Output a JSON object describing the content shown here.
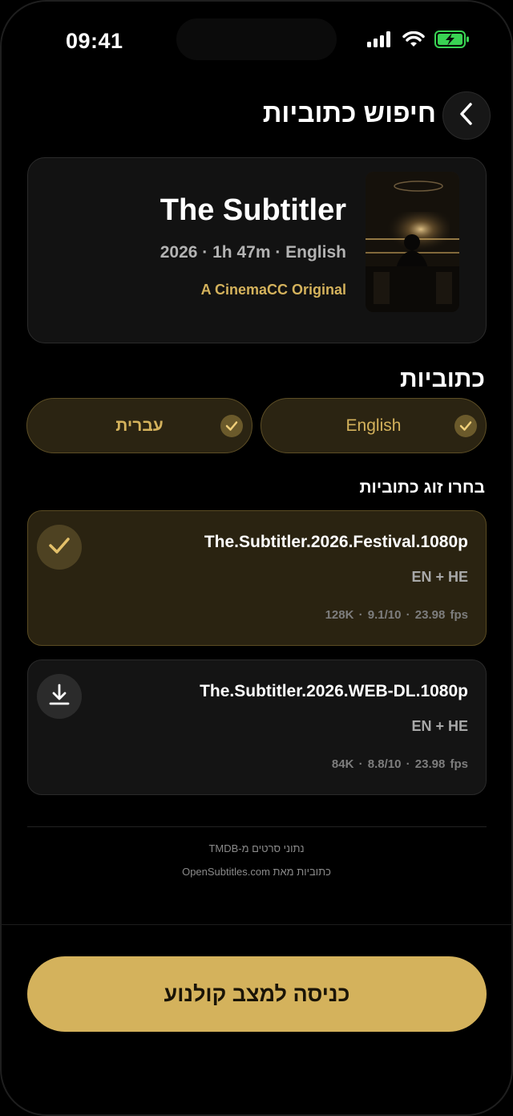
{
  "status_bar": {
    "time": "09:41",
    "icons": [
      "signal-icon",
      "wifi-icon",
      "battery-charging-icon"
    ],
    "battery_color": "#39d353"
  },
  "header": {
    "title": "חיפוש כתוביות",
    "back_icon": "chevron-left-icon"
  },
  "movie": {
    "title": "The Subtitler",
    "meta": "2026 · 1h 47m · English",
    "badge": "A CinemaCC Original"
  },
  "subtitles": {
    "section_title": "כתוביות",
    "languages": [
      {
        "label": "עברית",
        "selected": true
      },
      {
        "label": "English",
        "selected": true
      }
    ],
    "pair_title": "בחרו זוג כתוביות",
    "results": [
      {
        "name": "The.Subtitler.2026.Festival.1080p",
        "langs": "EN + HE",
        "stats": "128K · 9.1/10 · 23.98 fps",
        "selected": true,
        "icon": "check-icon"
      },
      {
        "name": "The.Subtitler.2026.WEB-DL.1080p",
        "langs": "EN + HE",
        "stats": "84K · 8.8/10 · 23.98 fps",
        "selected": false,
        "icon": "download-icon"
      }
    ]
  },
  "footer": {
    "credit_line1": "נתוני סרטים מ-TMDB",
    "credit_line2": "כתוביות מאת OpenSubtitles.com"
  },
  "cta": {
    "label": "כניסה למצב קולנוע"
  },
  "colors": {
    "accent": "#d4b25c",
    "background": "#000000",
    "card": "#121212",
    "selected_card": "#2a2311"
  }
}
